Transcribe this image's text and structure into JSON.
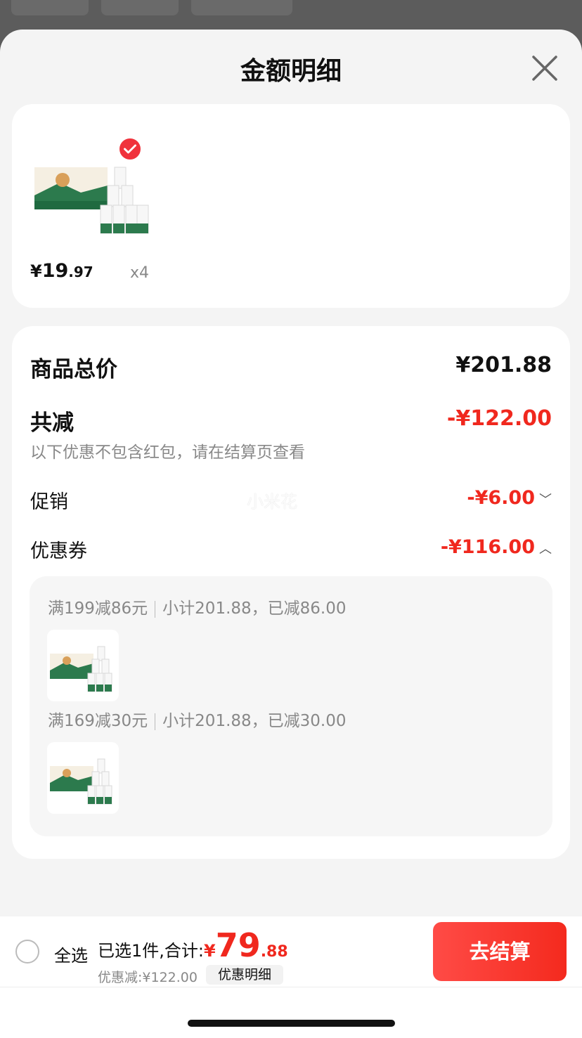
{
  "sheet": {
    "title": "金额明细"
  },
  "product": {
    "price_currency": "¥",
    "price_int": "19",
    "price_dec": ".97",
    "quantity": "x4"
  },
  "details": {
    "total_label": "商品总价",
    "total_value": "¥201.88",
    "reduce_label": "共减",
    "reduce_value": "-¥122.00",
    "hint": "以下优惠不包含红包，请在结算页查看",
    "promo_label": "促销",
    "promo_value": "-¥6.00",
    "coupon_label": "优惠券",
    "coupon_value": "-¥116.00",
    "watermark": "小米花",
    "coupons": [
      {
        "rule": "满199减86元",
        "detail": "小计201.88，已减86.00"
      },
      {
        "rule": "满169减30元",
        "detail": "小计201.88，已减30.00"
      }
    ]
  },
  "bottom": {
    "select_all": "全选",
    "summary_text": "已选1件,合计:",
    "total_currency": "¥",
    "total_int": "79",
    "total_dec": ".88",
    "discount_text": "优惠减:¥122.00",
    "detail_button": "优惠明细",
    "checkout_button": "去结算"
  },
  "colors": {
    "accent": "#f0281e",
    "sheet_bg": "#f4f4f4",
    "check_badge": "#f0323c"
  },
  "icons": {
    "close": "close-icon",
    "check": "check-icon",
    "chevron_down": "chevron-down-icon",
    "chevron_up": "chevron-up-icon"
  }
}
